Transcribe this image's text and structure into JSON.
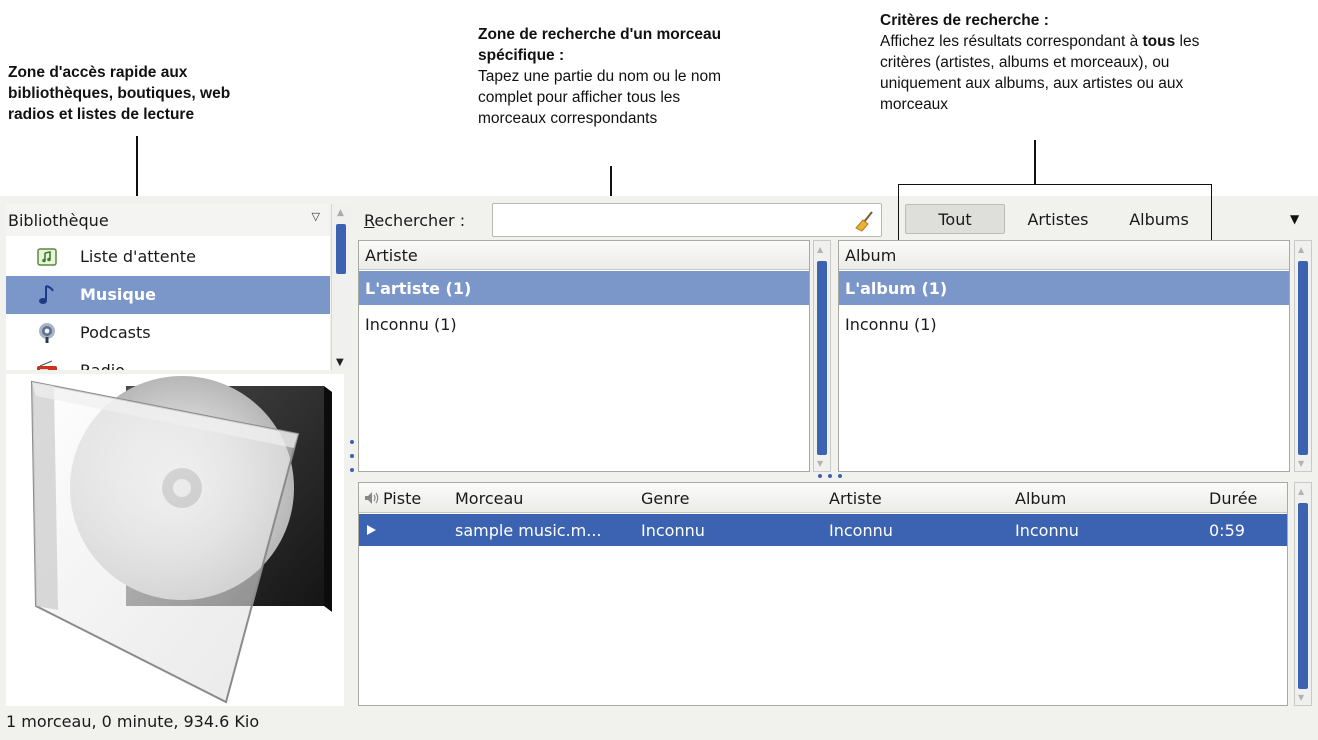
{
  "annotations": {
    "library_zone": {
      "lines": [
        "Zone d'accès rapide aux",
        "bibliothèques, boutiques, web",
        "radios et listes de lecture"
      ]
    },
    "search_zone": {
      "title_lines": [
        "Zone de recherche d'un morceau",
        "spécifique :"
      ],
      "body_lines": [
        "Tapez une partie du nom ou le nom",
        "complet pour afficher tous les",
        "morceaux correspondants"
      ]
    },
    "criteria_zone": {
      "title": "Critères de recherche :",
      "line1_pre": "Affichez les résultats correspondant à ",
      "line1_bold": "tous",
      "line1_post": " les",
      "body_lines": [
        "critères (artistes, albums et morceaux), ou",
        "uniquement aux albums, aux artistes ou aux",
        "morceaux"
      ]
    }
  },
  "sidebar": {
    "selector_label": "Bibliothèque",
    "items": [
      {
        "label": "Liste d'attente",
        "icon": "queue-icon",
        "selected": false
      },
      {
        "label": "Musique",
        "icon": "music-note-icon",
        "selected": true
      },
      {
        "label": "Podcasts",
        "icon": "podcast-icon",
        "selected": false
      },
      {
        "label": "Radio",
        "icon": "radio-icon",
        "selected": false
      }
    ],
    "cover_art": "cd-case-icon"
  },
  "search": {
    "label_accel": "R",
    "label_rest": "echercher :",
    "value": "",
    "clear_icon": "broom-icon"
  },
  "criteria": {
    "buttons": [
      "Tout",
      "Artistes",
      "Albums"
    ],
    "active": "Tout"
  },
  "artist_pane": {
    "header": "Artiste",
    "rows": [
      "L'artiste (1)",
      "Inconnu (1)"
    ],
    "selected_index": 0
  },
  "album_pane": {
    "header": "Album",
    "rows": [
      "L'album (1)",
      "Inconnu (1)"
    ],
    "selected_index": 0
  },
  "tracks": {
    "columns": [
      "Piste",
      "Morceau",
      "Genre",
      "Artiste",
      "Album",
      "Durée"
    ],
    "rows": [
      {
        "piste": "",
        "morceau": "sample music.m...",
        "genre": "Inconnu",
        "artiste": "Inconnu",
        "album": "Inconnu",
        "duree": "0:59",
        "playing": true
      }
    ]
  },
  "status": "1 morceau, 0 minute, 934.6 Kio",
  "colors": {
    "selection": "#7b96c8",
    "accent": "#3c63b2",
    "chrome": "#f1f1ee"
  }
}
